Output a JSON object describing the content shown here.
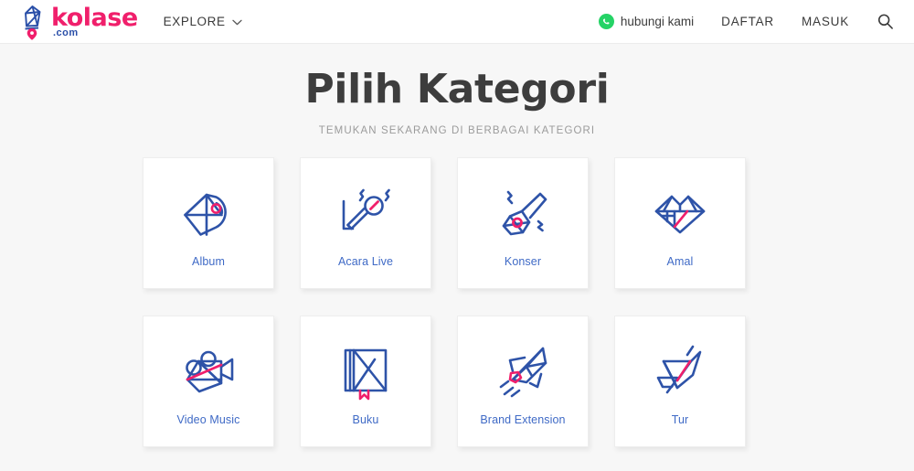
{
  "header": {
    "logo": {
      "name": "kolase",
      "suffix": ".com",
      "mark_icon": "kolase-origami-pin-logo-icon",
      "brand_pink": "#f01f6b",
      "brand_blue": "#2a4fa8"
    },
    "explore": {
      "label": "EXPLORE",
      "chevron_icon": "chevron-down-icon"
    },
    "whatsapp": {
      "label": "hubungi kami",
      "icon": "whatsapp-icon",
      "color": "#25d366"
    },
    "register_label": "DAFTAR",
    "login_label": "MASUK",
    "search_icon": "search-icon"
  },
  "main": {
    "title": "Pilih Kategori",
    "subtitle": "TEMUKAN SEKARANG DI BERBAGAI KATEGORI",
    "accent_blue": "#2e53a8",
    "accent_pink": "#f01f6b",
    "label_blue": "#3f6ac6",
    "categories": [
      {
        "label": "Album",
        "icon": "album-vinyl-origami-icon"
      },
      {
        "label": "Acara Live",
        "icon": "microphone-origami-icon"
      },
      {
        "label": "Konser",
        "icon": "guitar-origami-icon"
      },
      {
        "label": "Amal",
        "icon": "diamond-heart-origami-icon"
      },
      {
        "label": "Video Music",
        "icon": "film-camera-origami-icon"
      },
      {
        "label": "Buku",
        "icon": "book-bookmark-origami-icon"
      },
      {
        "label": "Brand Extension",
        "icon": "rocket-origami-icon"
      },
      {
        "label": "Tur",
        "icon": "paper-plane-origami-icon"
      }
    ]
  }
}
